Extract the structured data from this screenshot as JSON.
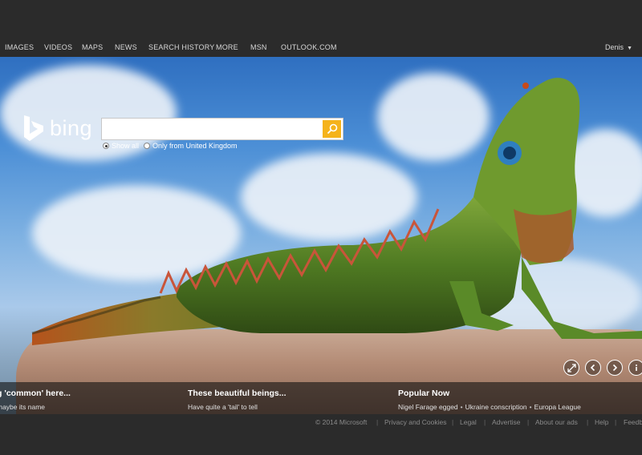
{
  "nav": {
    "items": [
      "IMAGES",
      "VIDEOS",
      "MAPS",
      "NEWS",
      "SEARCH HISTORY",
      "MORE",
      "MSN",
      "OUTLOOK.COM"
    ],
    "user": "Denis"
  },
  "logo": {
    "text": "bing"
  },
  "search": {
    "value": "",
    "scope_all": "Show all",
    "scope_uk": "Only from United Kingdom"
  },
  "stories": [
    {
      "title": "g 'common' here...",
      "sub": "maybe its name"
    },
    {
      "title": "These beautiful beings...",
      "sub": "Have quite a 'tail' to tell"
    },
    {
      "title": "Popular Now",
      "links": [
        "Nigel Farage egged",
        "Ukraine conscription",
        "Europa League"
      ]
    }
  ],
  "footer": {
    "copyright": "© 2014 Microsoft",
    "links": [
      "Privacy and Cookies",
      "Legal",
      "Advertise",
      "About our ads",
      "Help",
      "Feedb"
    ]
  },
  "colors": {
    "accent": "#f5b31b",
    "bar": "#2b2b2b"
  },
  "icons": [
    "bing-logo-icon",
    "search-icon",
    "expand-icon",
    "previous-arrow-icon",
    "next-arrow-icon",
    "info-icon"
  ]
}
